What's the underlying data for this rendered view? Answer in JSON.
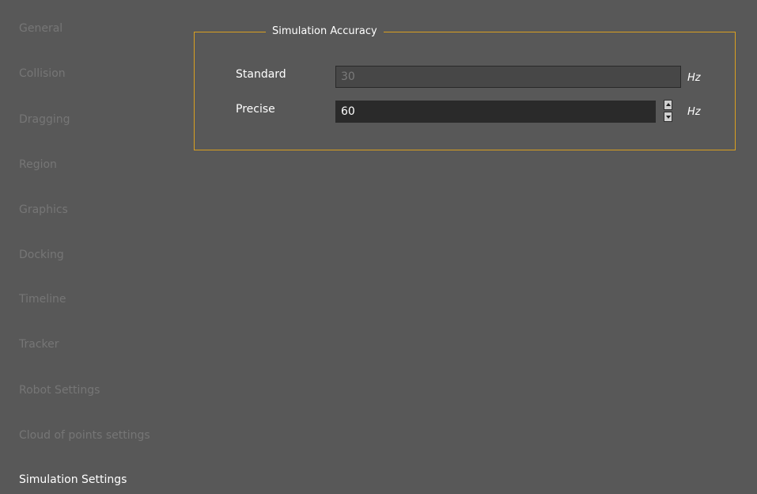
{
  "sidebar": {
    "items": [
      {
        "label": "General"
      },
      {
        "label": "Collision"
      },
      {
        "label": "Dragging"
      },
      {
        "label": "Region"
      },
      {
        "label": "Graphics"
      },
      {
        "label": "Docking"
      },
      {
        "label": "Timeline"
      },
      {
        "label": "Tracker"
      },
      {
        "label": "Robot Settings"
      },
      {
        "label": "Cloud of points settings"
      },
      {
        "label": "Simulation Settings",
        "selected": true
      }
    ]
  },
  "accuracy": {
    "title": "Simulation Accuracy",
    "standard": {
      "label": "Standard",
      "value": "30",
      "unit": "Hz"
    },
    "precise": {
      "label": "Precise",
      "value": "60",
      "unit": "Hz"
    }
  },
  "colors": {
    "background": "#585858",
    "group_border": "#d9a020",
    "field_active": "#2a2a2a",
    "field_disabled": "#474747"
  }
}
